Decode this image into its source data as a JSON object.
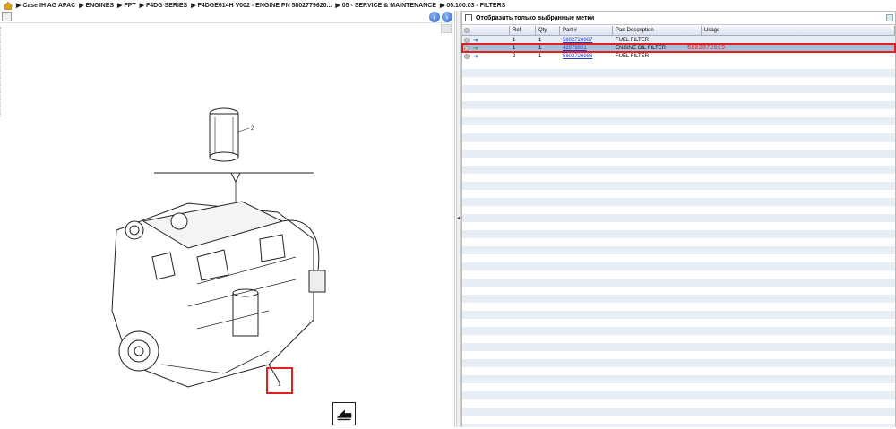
{
  "breadcrumb": {
    "items": [
      "▶ Case IH AG APAC",
      "▶ ENGINES",
      "▶ FPT",
      "▶ F4DG SERIES",
      "▶ F4DGE614H V002 - ENGINE PN 5802779620...",
      "▶ 05 - SERVICE & MAINTENANCE",
      "▶ 05.100.03 - FILTERS"
    ]
  },
  "drawing": {
    "filter_callout": "2",
    "engine_callout": "1"
  },
  "filter_bar": {
    "label": "Отобразить только выбранные метки"
  },
  "grid": {
    "headers": {
      "ref": "Ref",
      "qty": "Qty",
      "part": "Part #",
      "desc": "Part Description",
      "usage": "Usage"
    },
    "rows": [
      {
        "ref": "1",
        "qty": "1",
        "part": "5802726987",
        "desc": "FUEL FILTER",
        "note": ""
      },
      {
        "ref": "1",
        "qty": "1",
        "part": "42579931",
        "desc": "ENGINE OIL FILTER",
        "note": "5802872619"
      },
      {
        "ref": "2",
        "qty": "1",
        "part": "5802726986",
        "desc": "FUEL FILTER",
        "note": ""
      }
    ]
  },
  "colors": {
    "highlight": "#e02020",
    "selected_row": "#a9bfdc",
    "link": "#1a3bd6"
  }
}
